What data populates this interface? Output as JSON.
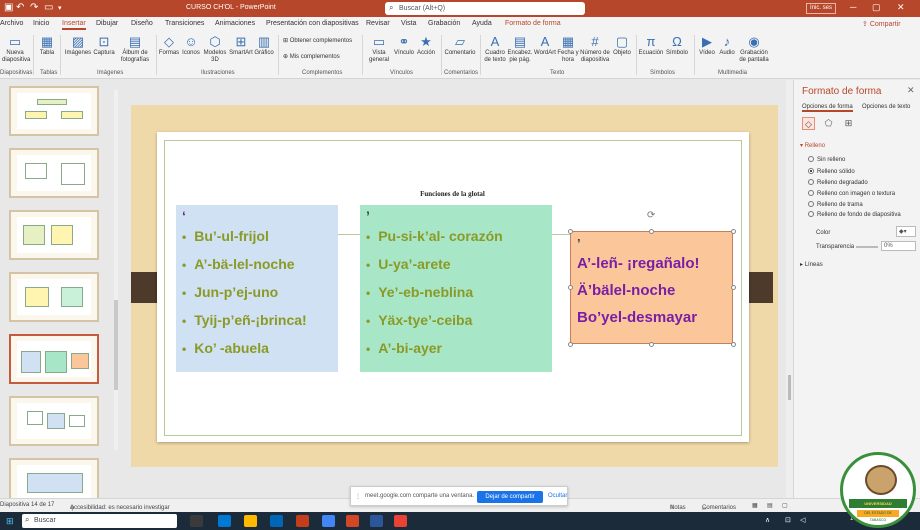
{
  "app": {
    "title": "CURSO CH'OL - PowerPoint",
    "search": "Buscar (Alt+Q)",
    "signin": "Inic. ses"
  },
  "tabs": [
    "Archivo",
    "Inicio",
    "Insertar",
    "Dibujar",
    "Diseño",
    "Transiciones",
    "Animaciones",
    "Presentación con diapositivas",
    "Revisar",
    "Vista",
    "Grabación",
    "Ayuda",
    "Formato de forma"
  ],
  "share": "Compartir",
  "ribbon": {
    "buttons": [
      "Nueva diapositiva",
      "Tabla",
      "Imágenes",
      "Captura",
      "Álbum de fotografías",
      "Formas",
      "Iconos",
      "Modelos 3D",
      "SmartArt",
      "Gráfico",
      "Obtener complementos",
      "Mis complementos",
      "Vista general",
      "Vínculo",
      "Acción",
      "Comentario",
      "Cuadro de texto",
      "Encabez. pie pág.",
      "WordArt",
      "Fecha y hora",
      "Número de diapositiva",
      "Objeto",
      "Ecuación",
      "Símbolo",
      "Vídeo",
      "Audio",
      "Grabación de pantalla"
    ],
    "groups": [
      "Diapositivas",
      "Tablas",
      "Imágenes",
      "Ilustraciones",
      "Complementos",
      "Vínculos",
      "Comentarios",
      "Texto",
      "Símbolos",
      "Multimedia"
    ]
  },
  "slide": {
    "title": "Funciones de la glotal",
    "box1": {
      "mark": "‘",
      "items": [
        "Bu’-ul-frijol",
        "A’-bä-lel-noche",
        "Jun-p’ej-uno",
        "Tyij-p’eñ-¡brinca!",
        "Ko’ -abuela"
      ]
    },
    "box2": {
      "mark": "’",
      "items": [
        "Pu-si-k’al-   corazón",
        "U-ya’-arete",
        "Ye’-eb-neblina",
        "Yäx-tye’-ceiba",
        "A’-bi-ayer"
      ]
    },
    "box3": {
      "mark": "’",
      "lines": [
        "A’-leñ- ¡regañalo!",
        "Ä’bälel-noche",
        "Bo’yel-desmayar"
      ]
    }
  },
  "pane": {
    "title": "Formato de forma",
    "subtabs": [
      "Opciones de forma",
      "Opciones de texto"
    ],
    "relleno": "Relleno",
    "options": [
      "Sin relleno",
      "Relleno sólido",
      "Relleno degradado",
      "Relleno con imagen o textura",
      "Relleno de trama",
      "Relleno de fondo de diapositiva"
    ],
    "color": "Color",
    "transparencia": "Transparencia",
    "transparencia_value": "0%",
    "lineas": "Líneas"
  },
  "status": {
    "slide": "Diapositiva 14 de 17",
    "accessibility": "Accesibilidad: es necesario investigar",
    "notas": "Notas",
    "comentarios": "Comentarios"
  },
  "notice": {
    "text": "meet.google.com comparte una ventana.",
    "stop": "Dejar de compartir",
    "hide": "Ocultar"
  },
  "taskbar": {
    "search": "Buscar",
    "date": "17/05/2023"
  },
  "logo": {
    "text": "UNIVERSIDAD INTERCULTURAL",
    "sub": "DEL ESTADO DE TABASCO"
  },
  "colors": {
    "accent": "#b7472a",
    "box1": "#cfe1f2",
    "box2": "#a8e6c8",
    "box3": "#fbc79a",
    "olive": "#8a9a25",
    "purple": "#7a1ea5"
  }
}
